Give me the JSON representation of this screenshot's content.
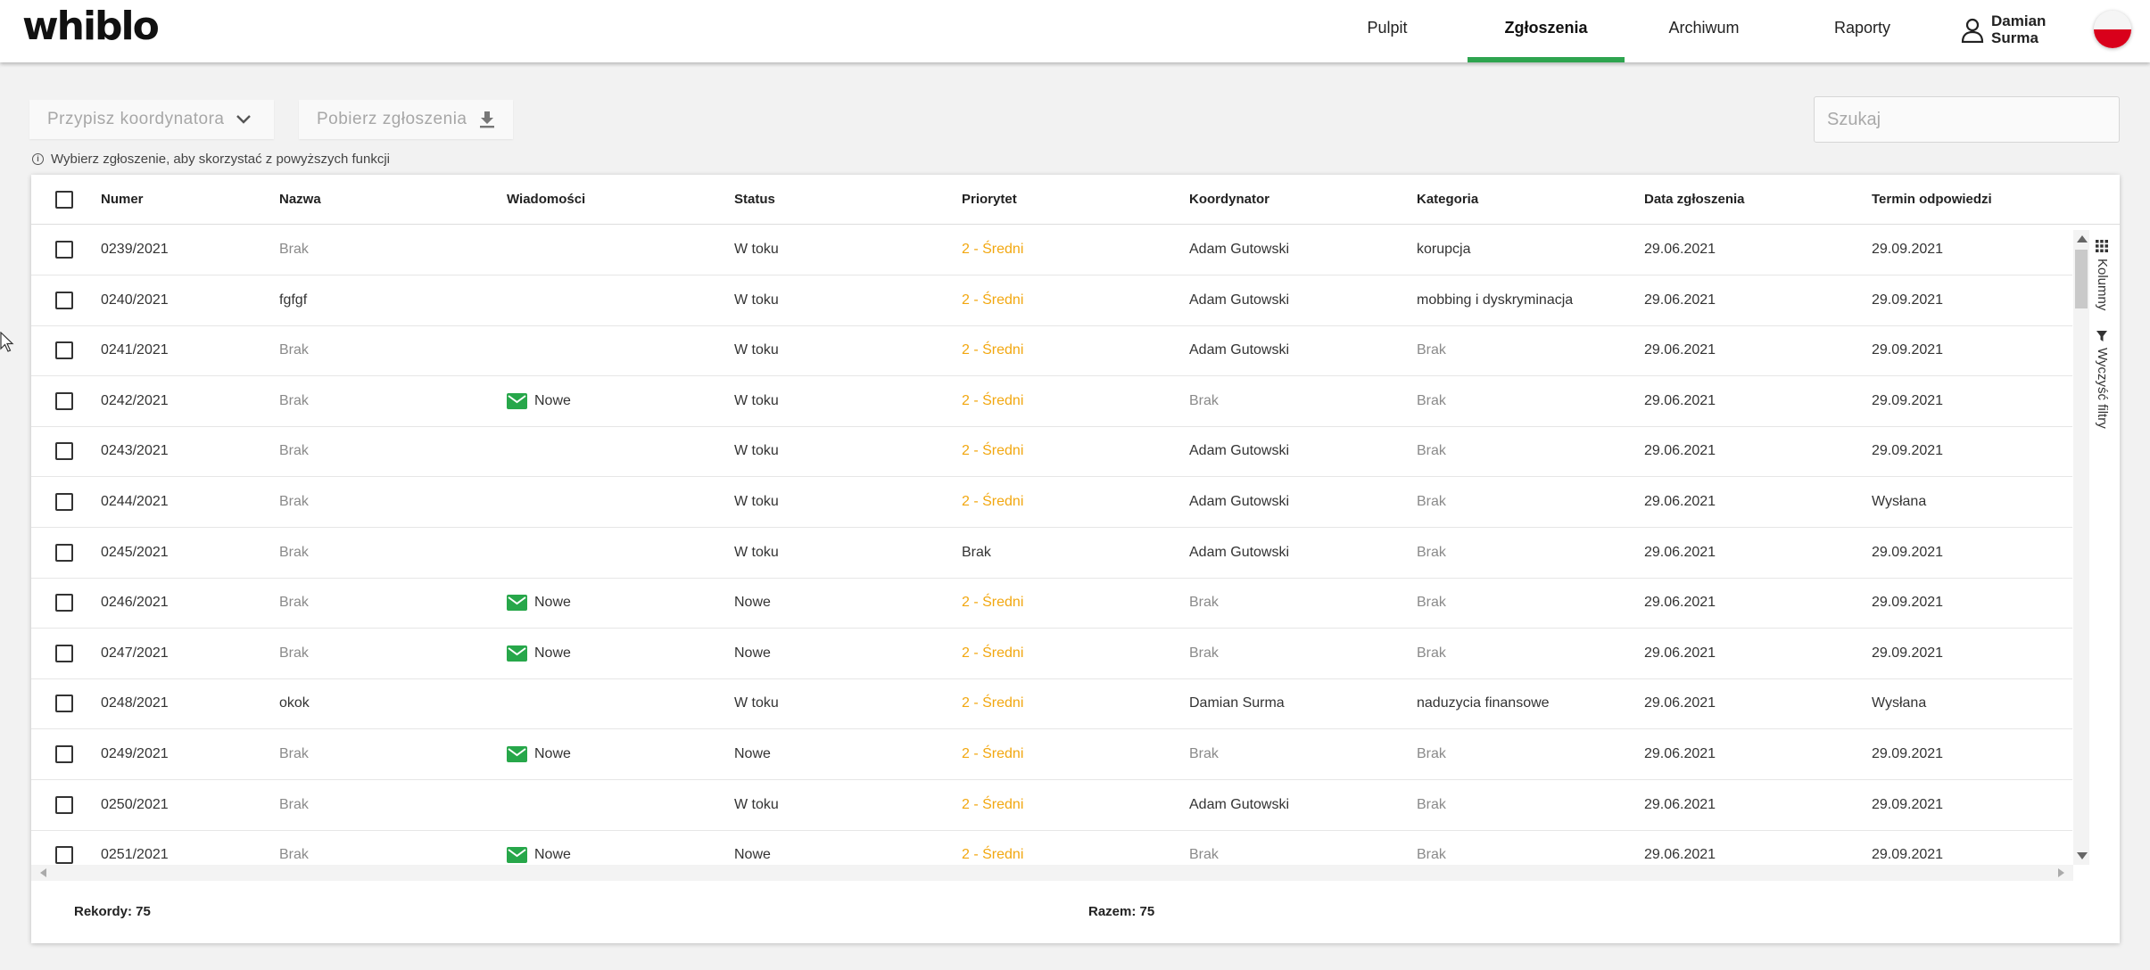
{
  "app": {
    "logo": "whiblo"
  },
  "nav": {
    "items": [
      {
        "label": "Pulpit",
        "active": false
      },
      {
        "label": "Zgłoszenia",
        "active": true
      },
      {
        "label": "Archiwum",
        "active": false
      },
      {
        "label": "Raporty",
        "active": false
      }
    ],
    "user_line1": "Damian",
    "user_line2": "Surma"
  },
  "toolbar": {
    "assign_label": "Przypisz koordynatora",
    "download_label": "Pobierz zgłoszenia",
    "search_placeholder": "Szukaj",
    "hint": "Wybierz zgłoszenie, aby skorzystać z powyższych funkcji"
  },
  "table": {
    "columns": [
      "Numer",
      "Nazwa",
      "Wiadomości",
      "Status",
      "Priorytet",
      "Koordynator",
      "Kategoria",
      "Data zgłoszenia",
      "Termin odpowiedzi"
    ],
    "rows": [
      [
        "0239/2021",
        "Brak",
        "",
        "W toku",
        "2 - Średni",
        "Adam Gutowski",
        "korupcja",
        "29.06.2021",
        "29.09.2021"
      ],
      [
        "0240/2021",
        "fgfgf",
        "",
        "W toku",
        "2 - Średni",
        "Adam Gutowski",
        "mobbing i dyskryminacja",
        "29.06.2021",
        "29.09.2021"
      ],
      [
        "0241/2021",
        "Brak",
        "",
        "W toku",
        "2 - Średni",
        "Adam Gutowski",
        "Brak",
        "29.06.2021",
        "29.09.2021"
      ],
      [
        "0242/2021",
        "Brak",
        "Nowe",
        "W toku",
        "2 - Średni",
        "Brak",
        "Brak",
        "29.06.2021",
        "29.09.2021"
      ],
      [
        "0243/2021",
        "Brak",
        "",
        "W toku",
        "2 - Średni",
        "Adam Gutowski",
        "Brak",
        "29.06.2021",
        "29.09.2021"
      ],
      [
        "0244/2021",
        "Brak",
        "",
        "W toku",
        "2 - Średni",
        "Adam Gutowski",
        "Brak",
        "29.06.2021",
        "Wysłana"
      ],
      [
        "0245/2021",
        "Brak",
        "",
        "W toku",
        "Brak",
        "Adam Gutowski",
        "Brak",
        "29.06.2021",
        "29.09.2021"
      ],
      [
        "0246/2021",
        "Brak",
        "Nowe",
        "Nowe",
        "2 - Średni",
        "Brak",
        "Brak",
        "29.06.2021",
        "29.09.2021"
      ],
      [
        "0247/2021",
        "Brak",
        "Nowe",
        "Nowe",
        "2 - Średni",
        "Brak",
        "Brak",
        "29.06.2021",
        "29.09.2021"
      ],
      [
        "0248/2021",
        "okok",
        "",
        "W toku",
        "2 - Średni",
        "Damian Surma",
        "naduzycia finansowe",
        "29.06.2021",
        "Wysłana"
      ],
      [
        "0249/2021",
        "Brak",
        "Nowe",
        "Nowe",
        "2 - Średni",
        "Brak",
        "Brak",
        "29.06.2021",
        "29.09.2021"
      ],
      [
        "0250/2021",
        "Brak",
        "",
        "W toku",
        "2 - Średni",
        "Adam Gutowski",
        "Brak",
        "29.06.2021",
        "29.09.2021"
      ],
      [
        "0251/2021",
        "Brak",
        "Nowe",
        "Nowe",
        "2 - Średni",
        "Brak",
        "Brak",
        "29.06.2021",
        "29.09.2021"
      ]
    ]
  },
  "side_panel": {
    "columns_label": "Kolumny",
    "clear_filters_label": "Wyczyść filtry"
  },
  "footer": {
    "records_label": "Rekordy: 75",
    "total_label": "Razem: 75"
  },
  "colors": {
    "accent": "#2ea44f",
    "priority": "#f2a70f",
    "mail": "#27a74a"
  }
}
